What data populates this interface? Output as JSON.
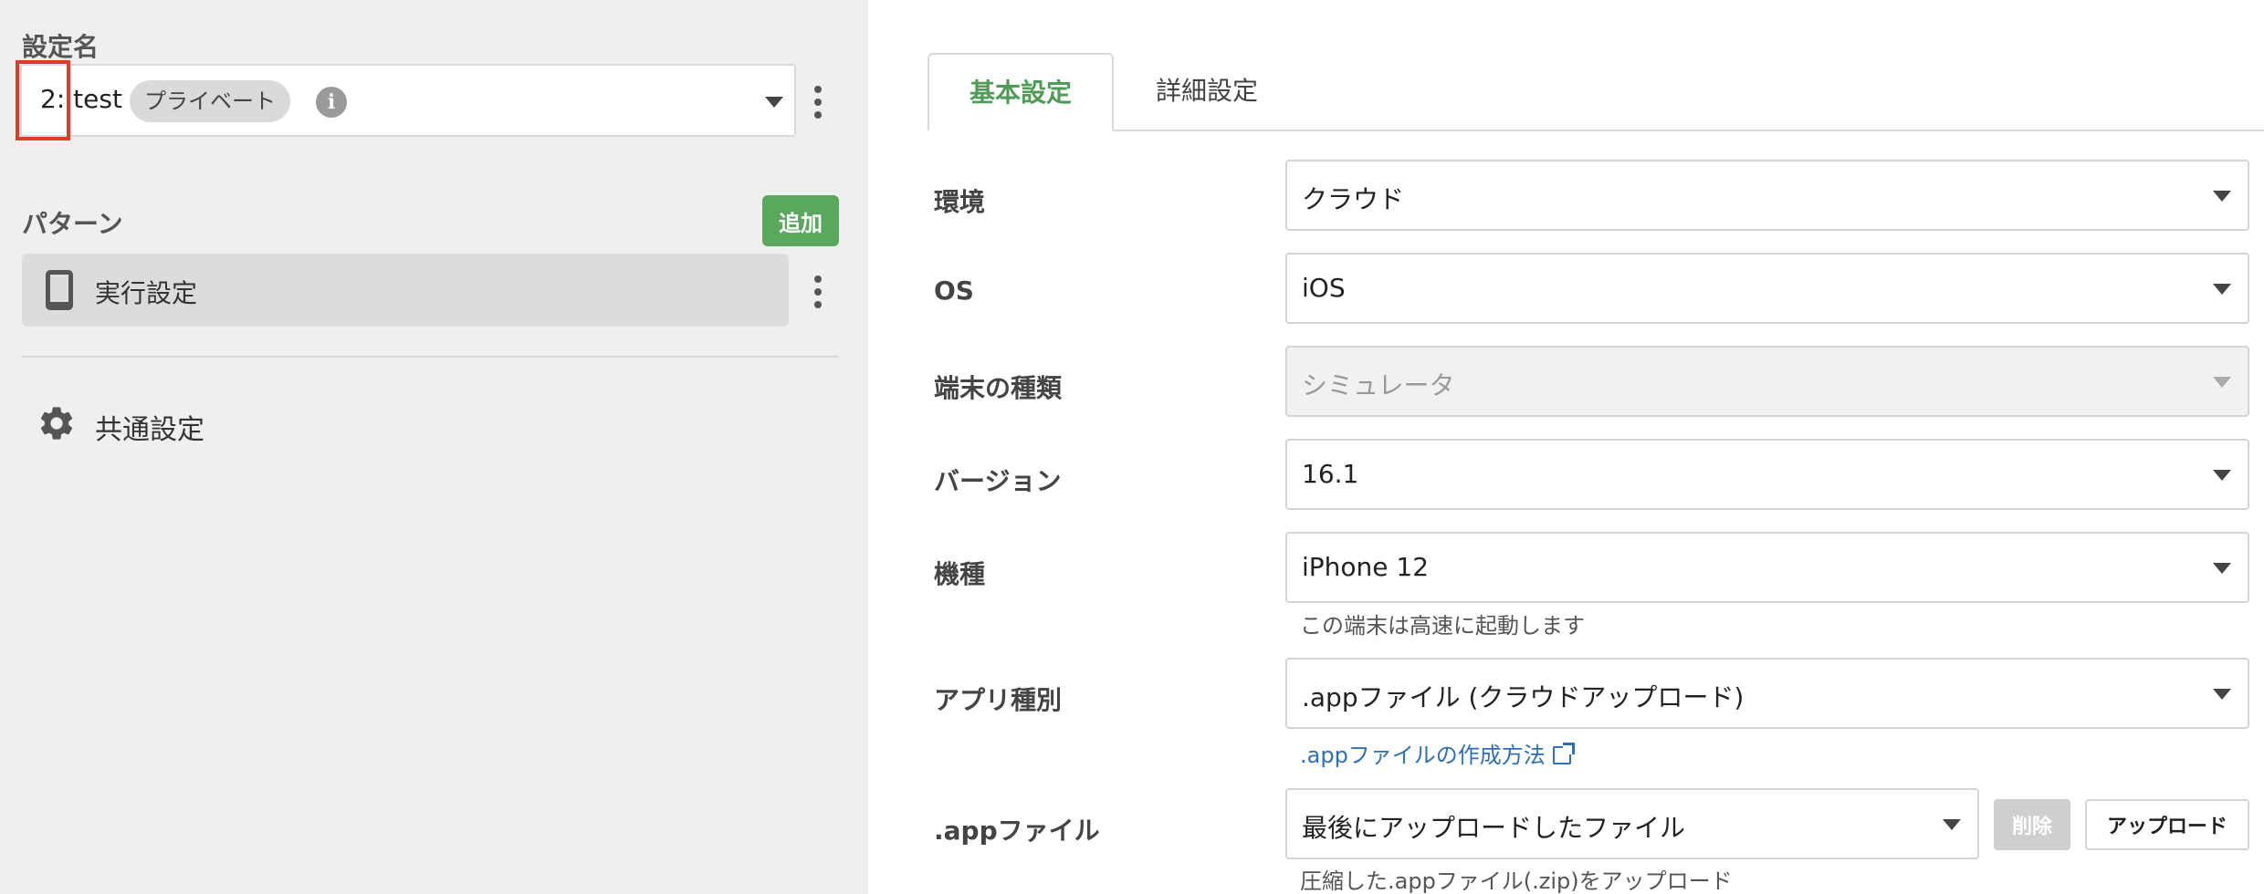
{
  "sidebar": {
    "config_section_label": "設定名",
    "config_name": "2: test",
    "private_badge": "プライベート",
    "info_icon_glyph": "i",
    "pattern_section_label": "パターン",
    "add_button": "追加",
    "pattern_item_label": "実行設定",
    "common_settings_label": "共通設定"
  },
  "tabs": [
    {
      "label": "基本設定",
      "active": true
    },
    {
      "label": "詳細設定",
      "active": false
    }
  ],
  "form": {
    "environment": {
      "label": "環境",
      "value": "クラウド"
    },
    "os": {
      "label": "OS",
      "value": "iOS"
    },
    "device_type": {
      "label": "端末の種類",
      "value": "シミュレータ",
      "disabled": true
    },
    "version": {
      "label": "バージョン",
      "value": "16.1"
    },
    "model": {
      "label": "機種",
      "value": "iPhone 12",
      "helper": "この端末は高速に起動します"
    },
    "app_type": {
      "label": "アプリ種別",
      "value": ".appファイル (クラウドアップロード)",
      "link": ".appファイルの作成方法"
    },
    "app_file": {
      "label": ".appファイル",
      "value": "最後にアップロードしたファイル",
      "helper": "圧縮した.appファイル(.zip)をアップロード",
      "delete_button": "削除",
      "upload_button": "アップロード"
    }
  },
  "colors": {
    "accent_green": "#5aa85e",
    "active_tab_text": "#4f9b57",
    "link_blue": "#2f6fb5",
    "highlight_red": "#e03a2a"
  }
}
